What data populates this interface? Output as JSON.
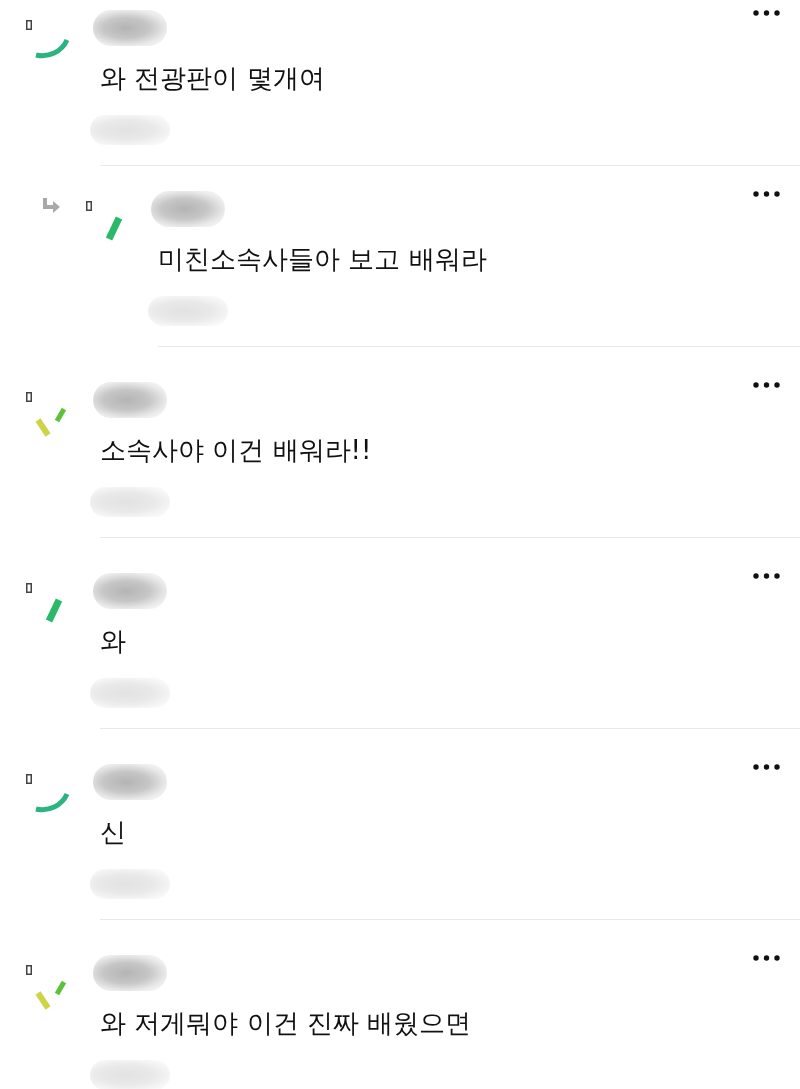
{
  "comments": [
    {
      "reply": false,
      "avatar": {
        "kind": "arc"
      },
      "text": "와 전광판이 몇개여"
    },
    {
      "reply": true,
      "avatar": {
        "kind": "slash"
      },
      "text": "미친소속사들아 보고 배워라"
    },
    {
      "reply": false,
      "avatar": {
        "kind": "ticks"
      },
      "text": "소속사야 이건 배워라!!"
    },
    {
      "reply": false,
      "avatar": {
        "kind": "slash"
      },
      "text": "와"
    },
    {
      "reply": false,
      "avatar": {
        "kind": "arc"
      },
      "text": "신"
    },
    {
      "reply": false,
      "avatar": {
        "kind": "ticks"
      },
      "text": "와 저게뭐야 이건 진짜 배웠으면"
    }
  ]
}
